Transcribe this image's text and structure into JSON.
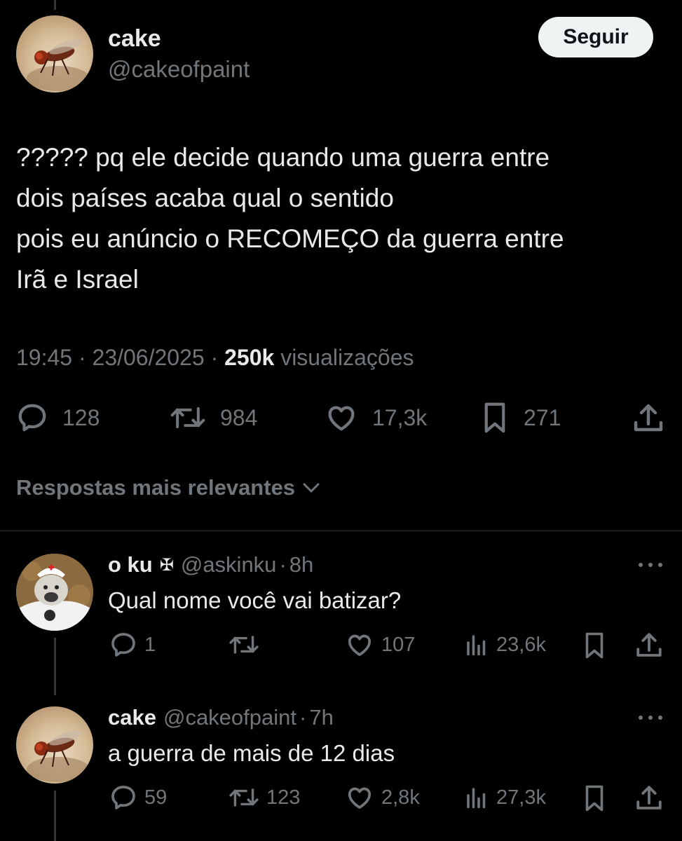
{
  "tweet": {
    "author_name": "cake",
    "author_handle": "@cakeofpaint",
    "follow_label": "Seguir",
    "text": "????? pq ele decide quando uma guerra entre\ndois países acaba qual o sentido\npois eu anúncio o RECOMEÇO da guerra entre\nIrã e Israel",
    "time": "19:45",
    "date": "23/06/2025",
    "views_count": "250k",
    "views_label": "visualizações",
    "stats": {
      "replies": "128",
      "retweets": "984",
      "likes": "17,3k",
      "bookmarks": "271"
    }
  },
  "sort": {
    "label": "Respostas mais relevantes"
  },
  "replies": [
    {
      "name": "o ku",
      "badge": "✠",
      "handle": "@askinku",
      "time": "8h",
      "text": "Qual nome você vai batizar?",
      "replies": "1",
      "retweets": "",
      "likes": "107",
      "views": "23,6k"
    },
    {
      "name": "cake",
      "handle": "@cakeofpaint",
      "time": "7h",
      "text": "a guerra de mais de 12 dias",
      "replies": "59",
      "retweets": "123",
      "likes": "2,8k",
      "views": "27,3k"
    }
  ],
  "separator": "·"
}
